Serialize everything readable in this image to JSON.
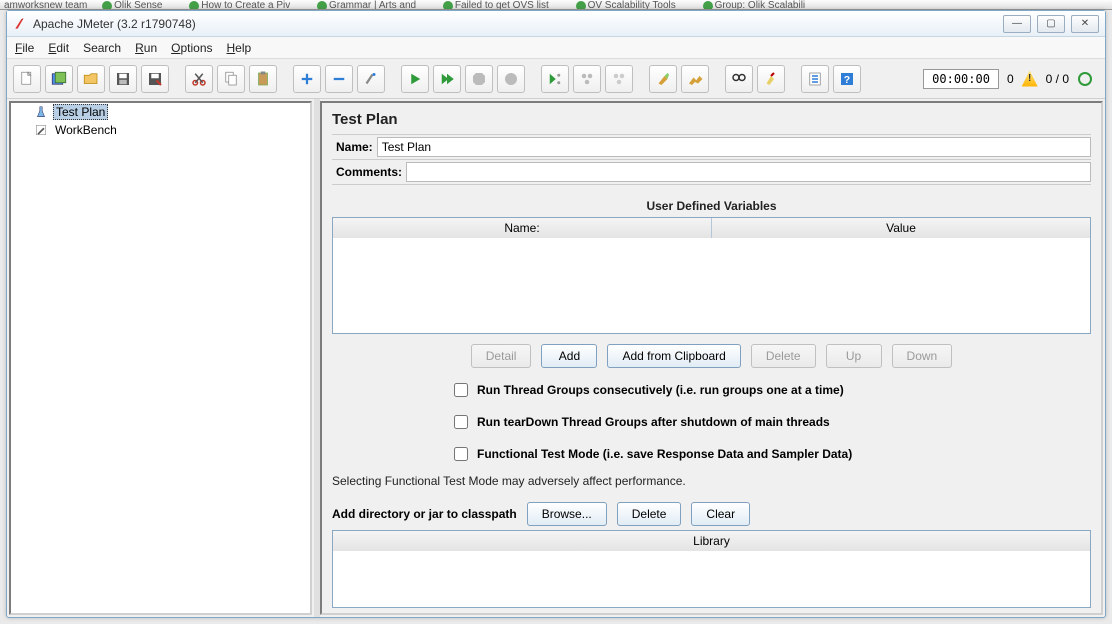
{
  "browser_tabs": [
    "amworksnew team",
    "Olik Sense",
    "How to Create a Piv",
    "Grammar | Arts and",
    "Failed to get OVS list",
    "OV Scalability Tools",
    "Group: Olik Scalabili"
  ],
  "window": {
    "title": "Apache JMeter (3.2 r1790748)"
  },
  "menu": {
    "file": "File",
    "edit": "Edit",
    "search": "Search",
    "run": "Run",
    "options": "Options",
    "help": "Help"
  },
  "toolbar_status": {
    "timer": "00:00:00",
    "warn_count": "0",
    "threads": "0 / 0"
  },
  "tree": {
    "items": [
      {
        "label": "Test Plan",
        "selected": true,
        "icon": "flask"
      },
      {
        "label": "WorkBench",
        "selected": false,
        "icon": "pencil"
      }
    ]
  },
  "panel": {
    "title": "Test Plan",
    "name_label": "Name:",
    "name_value": "Test Plan",
    "comments_label": "Comments:",
    "comments_value": "",
    "udv_title": "User Defined Variables",
    "udv_col_name": "Name:",
    "udv_col_value": "Value",
    "buttons": {
      "detail": "Detail",
      "add": "Add",
      "add_clipboard": "Add from Clipboard",
      "delete": "Delete",
      "up": "Up",
      "down": "Down"
    },
    "check_consecutive": "Run Thread Groups consecutively (i.e. run groups one at a time)",
    "check_teardown": "Run tearDown Thread Groups after shutdown of main threads",
    "check_functional": "Functional Test Mode (i.e. save Response Data and Sampler Data)",
    "note": "Selecting Functional Test Mode may adversely affect performance.",
    "classpath_label": "Add directory or jar to classpath",
    "browse": "Browse...",
    "cp_delete": "Delete",
    "cp_clear": "Clear",
    "library_header": "Library"
  }
}
